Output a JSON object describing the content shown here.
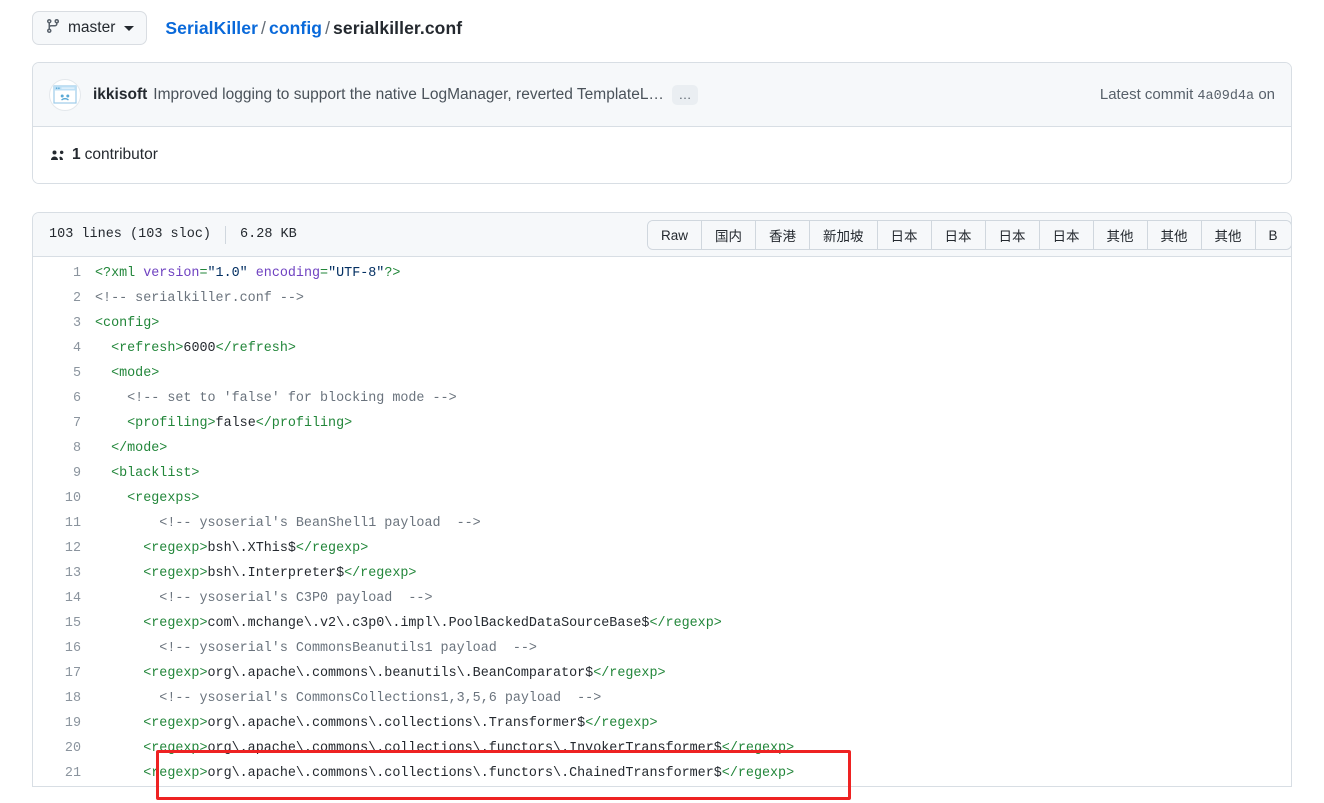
{
  "header": {
    "branch_button": {
      "label": "master",
      "icon": "branch-icon",
      "caret": "chevron-down-icon"
    },
    "breadcrumb": {
      "repo": "SerialKiller",
      "folder": "config",
      "file": "serialkiller.conf",
      "separator": "/"
    }
  },
  "commit": {
    "author": "ikkisoft",
    "message": "Improved logging to support the native LogManager, reverted TemplateL…",
    "expand_label": "…",
    "latest_label": "Latest commit",
    "sha": "4a09d4a",
    "on_label": "on",
    "contributors_count": "1",
    "contributors_label": "contributor"
  },
  "file": {
    "lines_text": "103 lines (103 sloc)",
    "size_text": "6.28 KB",
    "buttons": [
      "Raw",
      "国内",
      "香港",
      "新加坡",
      "日本",
      "日本",
      "日本",
      "日本",
      "其他",
      "其他",
      "其他",
      "B"
    ]
  },
  "code": {
    "line_numbers": [
      "1",
      "2",
      "3",
      "4",
      "5",
      "6",
      "7",
      "8",
      "9",
      "10",
      "11",
      "12",
      "13",
      "14",
      "15",
      "16",
      "17",
      "18",
      "19",
      "20",
      "21"
    ],
    "lines": [
      {
        "n": "1",
        "segs": [
          {
            "c": "t",
            "t": "<?xml "
          },
          {
            "c": "a",
            "t": "version"
          },
          {
            "c": "t",
            "t": "="
          },
          {
            "c": "s",
            "t": "\"1.0\""
          },
          {
            "c": "t",
            "t": " "
          },
          {
            "c": "a",
            "t": "encoding"
          },
          {
            "c": "t",
            "t": "="
          },
          {
            "c": "s",
            "t": "\"UTF-8\""
          },
          {
            "c": "t",
            "t": "?>"
          }
        ]
      },
      {
        "n": "2",
        "segs": [
          {
            "c": "c",
            "t": "<!-- serialkiller.conf -->"
          }
        ]
      },
      {
        "n": "3",
        "segs": [
          {
            "c": "t",
            "t": "<config>"
          }
        ]
      },
      {
        "n": "4",
        "segs": [
          {
            "c": "t",
            "t": "  <refresh>"
          },
          {
            "c": "x",
            "t": "6000"
          },
          {
            "c": "t",
            "t": "</refresh>"
          }
        ]
      },
      {
        "n": "5",
        "segs": [
          {
            "c": "t",
            "t": "  <mode>"
          }
        ]
      },
      {
        "n": "6",
        "segs": [
          {
            "c": "c",
            "t": "    <!-- set to 'false' for blocking mode -->"
          }
        ]
      },
      {
        "n": "7",
        "segs": [
          {
            "c": "t",
            "t": "    <profiling>"
          },
          {
            "c": "x",
            "t": "false"
          },
          {
            "c": "t",
            "t": "</profiling>"
          }
        ]
      },
      {
        "n": "8",
        "segs": [
          {
            "c": "t",
            "t": "  </mode>"
          }
        ]
      },
      {
        "n": "9",
        "segs": [
          {
            "c": "t",
            "t": "  <blacklist>"
          }
        ]
      },
      {
        "n": "10",
        "segs": [
          {
            "c": "t",
            "t": "    <regexps>"
          }
        ]
      },
      {
        "n": "11",
        "segs": [
          {
            "c": "c",
            "t": "        <!-- ysoserial's BeanShell1 payload  -->"
          }
        ]
      },
      {
        "n": "12",
        "segs": [
          {
            "c": "t",
            "t": "      <regexp>"
          },
          {
            "c": "x",
            "t": "bsh\\.XThis$"
          },
          {
            "c": "t",
            "t": "</regexp>"
          }
        ]
      },
      {
        "n": "13",
        "segs": [
          {
            "c": "t",
            "t": "      <regexp>"
          },
          {
            "c": "x",
            "t": "bsh\\.Interpreter$"
          },
          {
            "c": "t",
            "t": "</regexp>"
          }
        ]
      },
      {
        "n": "14",
        "segs": [
          {
            "c": "c",
            "t": "        <!-- ysoserial's C3P0 payload  -->"
          }
        ]
      },
      {
        "n": "15",
        "segs": [
          {
            "c": "t",
            "t": "      <regexp>"
          },
          {
            "c": "x",
            "t": "com\\.mchange\\.v2\\.c3p0\\.impl\\.PoolBackedDataSourceBase$"
          },
          {
            "c": "t",
            "t": "</regexp>"
          }
        ]
      },
      {
        "n": "16",
        "segs": [
          {
            "c": "c",
            "t": "        <!-- ysoserial's CommonsBeanutils1 payload  -->"
          }
        ]
      },
      {
        "n": "17",
        "segs": [
          {
            "c": "t",
            "t": "      <regexp>"
          },
          {
            "c": "x",
            "t": "org\\.apache\\.commons\\.beanutils\\.BeanComparator$"
          },
          {
            "c": "t",
            "t": "</regexp>"
          }
        ]
      },
      {
        "n": "18",
        "segs": [
          {
            "c": "c",
            "t": "        <!-- ysoserial's CommonsCollections1,3,5,6 payload  -->"
          }
        ]
      },
      {
        "n": "19",
        "segs": [
          {
            "c": "t",
            "t": "      <regexp>"
          },
          {
            "c": "x",
            "t": "org\\.apache\\.commons\\.collections\\.Transformer$"
          },
          {
            "c": "t",
            "t": "</regexp>"
          }
        ]
      },
      {
        "n": "20",
        "segs": [
          {
            "c": "t",
            "t": "      <regexp>"
          },
          {
            "c": "x",
            "t": "org\\.apache\\.commons\\.collections\\.functors\\.InvokerTransformer$"
          },
          {
            "c": "t",
            "t": "</regexp>"
          }
        ]
      },
      {
        "n": "21",
        "segs": [
          {
            "c": "t",
            "t": "      <regexp>"
          },
          {
            "c": "x",
            "t": "org\\.apache\\.commons\\.collections\\.functors\\.ChainedTransformer$"
          },
          {
            "c": "t",
            "t": "</regexp>"
          }
        ]
      }
    ]
  },
  "annotation": {
    "type": "red-rectangle",
    "color": "#ee2222",
    "covers_lines": [
      "20",
      "21"
    ]
  }
}
